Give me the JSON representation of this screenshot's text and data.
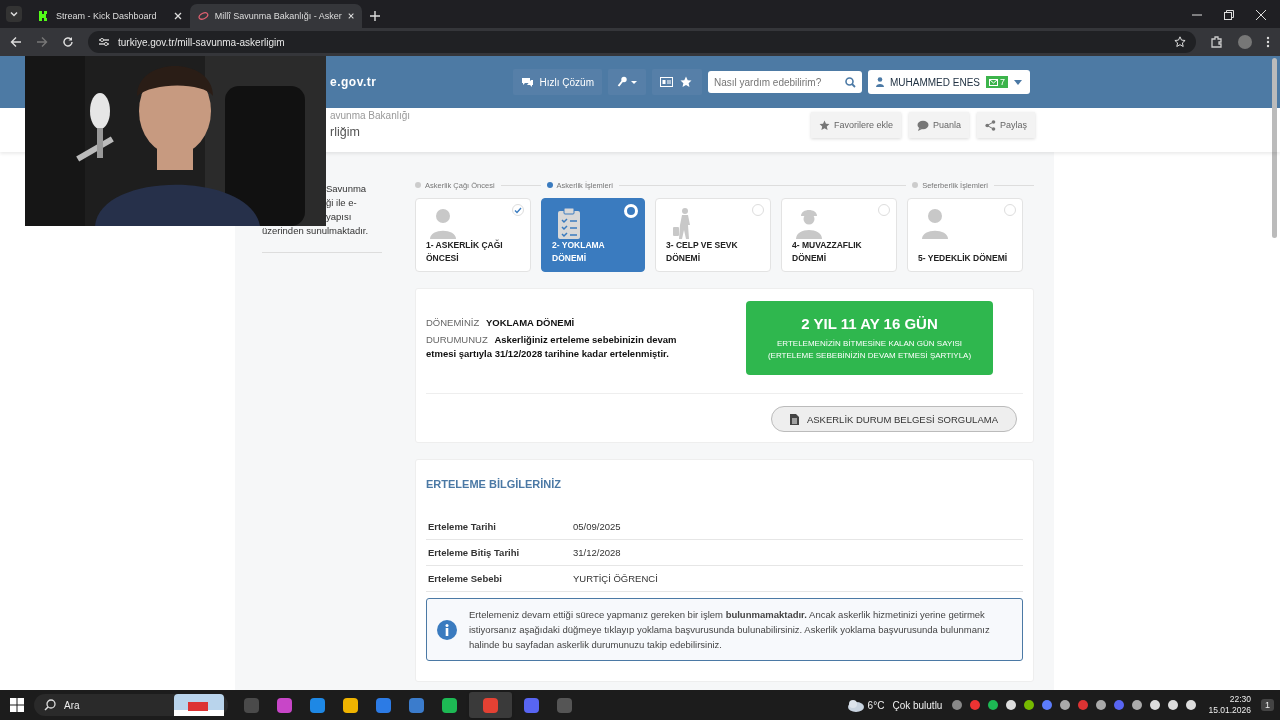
{
  "browser": {
    "tabs": [
      {
        "title": "Stream - Kick Dashboard",
        "selected": false
      },
      {
        "title": "Millî Savunma Bakanlığı - Asker",
        "selected": true
      }
    ],
    "url": "turkiye.gov.tr/mill-savunma-askerligim"
  },
  "webcam": {
    "kind": "picture"
  },
  "header": {
    "logo": "e.gov.tr",
    "quick": "Hızlı Çözüm",
    "search": {
      "placeholder": "Nasıl yardım edebilirim?"
    },
    "user": "MUHAMMED ENES",
    "mail_count": "7"
  },
  "breadcrumb": "avunma Bakanlığı",
  "page_title": "rliğim",
  "actions": [
    "Favorilere ekle",
    "Puanla",
    "Paylaş"
  ],
  "sidebar_text": [
    "Savunma",
    "ği ile e-",
    "yapısı",
    "üzerinden sunulmaktadır."
  ],
  "phases": [
    {
      "label": "Askerlik Çağı Öncesi",
      "active": false
    },
    {
      "label": "Askerlik İşlemleri",
      "active": true
    },
    {
      "label": "Seferberlik İşlemleri",
      "active": false
    }
  ],
  "steps": [
    {
      "label": "1- ASKERLİK ÇAĞI ÖNCESİ",
      "kind": "person",
      "selected": false,
      "checked": true
    },
    {
      "label": "2- YOKLAMA DÖNEMİ",
      "kind": "clipboard",
      "selected": true,
      "checked": false
    },
    {
      "label": "3- CELP VE SEVK DÖNEMİ",
      "kind": "traveler",
      "selected": false,
      "checked": false
    },
    {
      "label": "4- MUVAZZAFLIK DÖNEMİ",
      "kind": "soldier",
      "selected": false,
      "checked": false
    },
    {
      "label": "5- YEDEKLİK DÖNEMİ",
      "kind": "person",
      "selected": false,
      "checked": false
    }
  ],
  "status": {
    "period_label": "DÖNEMİNİZ",
    "period": "YOKLAMA DÖNEMİ",
    "state_label": "DURUMUNUZ",
    "state": "Askerliğiniz erteleme sebebinizin devam etmesi şartıyla 31/12/2028 tarihine kadar ertelenmiştir.",
    "remaining": "2 YIL 11 AY 16 GÜN",
    "remaining_caption": "ERTELEMENİZİN BİTMESİNE KALAN GÜN SAYISI",
    "remaining_note": "(ERTELEME SEBEBİNİZİN DEVAM ETMESİ ŞARTIYLA)",
    "document_button": "ASKERLİK DURUM BELGESİ SORGULAMA"
  },
  "deferral": {
    "title": "ERTELEME BİLGİLERİNİZ",
    "rows": [
      {
        "label": "Erteleme Tarihi",
        "value": "05/09/2025"
      },
      {
        "label": "Erteleme Bitiş Tarihi",
        "value": "31/12/2028"
      },
      {
        "label": "Erteleme Sebebi",
        "value": "YURTİÇİ ÖĞRENCİ"
      }
    ],
    "info": "Ertelemeniz devam ettiği sürece yapmanız gereken bir işlem **bulunmamaktadır.** Ancak askerlik hizmetinizi yerine getirmek istiyorsanız aşağıdaki düğmeye tıklayıp yoklama başvurusunda bulunabilirsiniz. Askerlik yoklama başvurusunda bulunmanız halinde bu sayfadan askerlik durumunuzu takip edebilirsiniz."
  },
  "taskbar": {
    "search": "Ara",
    "temperature": "6°C",
    "weather": "Çok bulutlu",
    "time": "22:30",
    "date": "15.01.2026",
    "notifications": "1"
  }
}
